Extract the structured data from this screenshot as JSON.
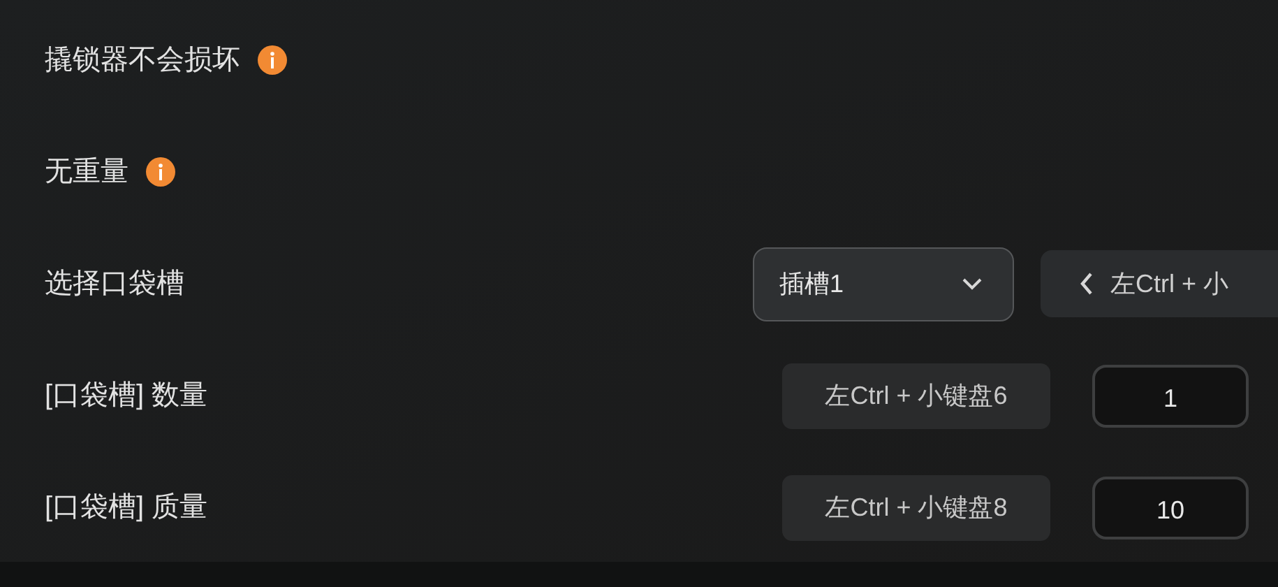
{
  "settings": [
    {
      "kind": "info",
      "label": "撬锁器不会损坏"
    },
    {
      "kind": "info",
      "label": "无重量"
    },
    {
      "kind": "select",
      "label": "选择口袋槽",
      "value": "插槽1",
      "hotkey": "左Ctrl + 小"
    },
    {
      "kind": "number",
      "label": "[口袋槽] 数量",
      "hotkey": "左Ctrl + 小键盘6",
      "value": "1"
    },
    {
      "kind": "number",
      "label": "[口袋槽] 质量",
      "hotkey": "左Ctrl + 小键盘8",
      "value": "10"
    }
  ]
}
